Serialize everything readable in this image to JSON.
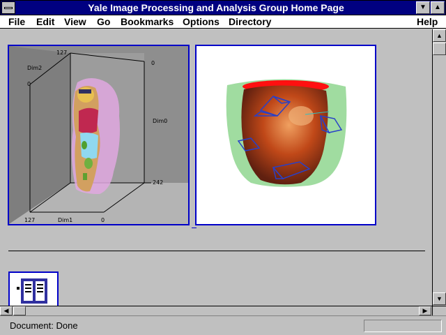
{
  "window": {
    "title": "Yale Image Processing and Analysis Group Home Page"
  },
  "menu": {
    "items": [
      "File",
      "Edit",
      "View",
      "Go",
      "Bookmarks",
      "Options",
      "Directory"
    ],
    "help": "Help"
  },
  "content": {
    "image1": {
      "labels": {
        "dim0": "Dim0",
        "dim1": "Dim1",
        "dim2": "Dim2",
        "tick_127_top": "127",
        "tick_0_left": "0",
        "tick_0_right": "0",
        "tick_242": "242",
        "tick_127_bottom": "127",
        "tick_0_bottom": "0"
      }
    }
  },
  "status": {
    "text": "Document: Done"
  },
  "colors": {
    "titlebar": "#000080",
    "link_border": "#0000c8",
    "window_bg": "#c0c0c0"
  }
}
